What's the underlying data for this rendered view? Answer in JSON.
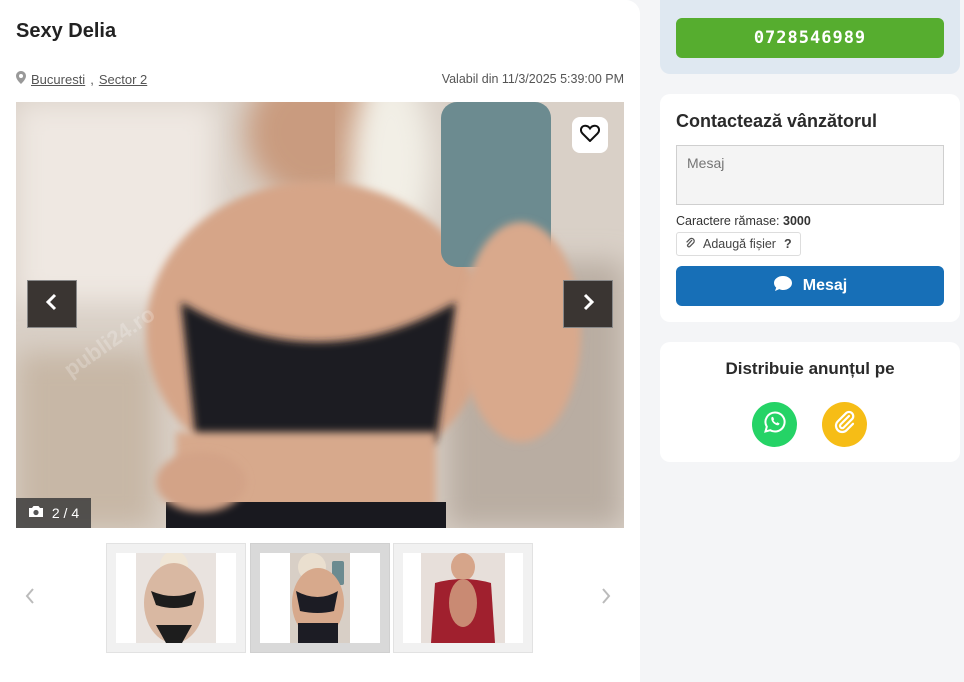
{
  "listing": {
    "title": "Sexy Delia",
    "location": {
      "city": "Bucuresti",
      "sector": "Sector 2"
    },
    "valid_from": "Valabil din 11/3/2025 5:39:00 PM"
  },
  "gallery": {
    "counter": "2 / 4",
    "current_index": 2,
    "total": 4,
    "watermark": "publi24.ro"
  },
  "icons": {
    "location": "map-pin-icon",
    "camera": "camera-icon",
    "prev": "chevron-left-icon",
    "next": "chevron-right-icon",
    "favorite": "heart-icon",
    "attach": "paperclip-icon",
    "message": "chat-bubble-icon",
    "whatsapp": "whatsapp-icon",
    "link": "link-icon"
  },
  "phone": {
    "number": "0728546989"
  },
  "contact": {
    "title": "Contactează vânzătorul",
    "message_placeholder": "Mesaj",
    "chars_label": "Caractere rămase:",
    "chars_remaining": "3000",
    "attach_label": "Adaugă fișier",
    "attach_help": "?",
    "send_label": "Mesaj"
  },
  "share": {
    "title": "Distribuie anunțul pe"
  },
  "colors": {
    "phone_button": "#56ad2f",
    "send_button": "#176fb7",
    "whatsapp": "#25d366",
    "copy_link": "#f6bd16"
  }
}
